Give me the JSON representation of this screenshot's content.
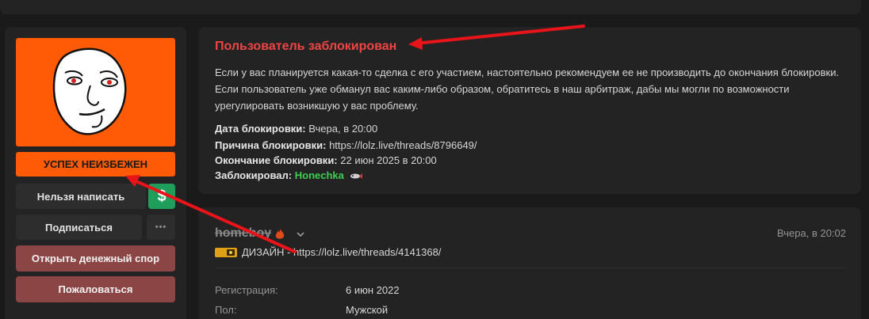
{
  "sidebar": {
    "banner_text": "УСПЕХ НЕИЗБЕЖЕН",
    "buttons": {
      "cannot_write": "Нельзя написать",
      "dollar": "$",
      "subscribe": "Подписаться",
      "more": "•••",
      "open_dispute": "Открыть денежный спор",
      "report": "Пожаловаться"
    }
  },
  "ban": {
    "title": "Пользователь заблокирован",
    "description": "Если у вас планируется какая-то сделка с его участием, настоятельно рекомендуем ее не производить до окончания блокировки. Если пользователь уже обманул вас каким-либо образом, обратитесь в наш арбитраж, дабы мы могли по возможности урегулировать возникшую у вас проблему.",
    "date_label": "Дата блокировки:",
    "date_value": "Вчера, в 20:00",
    "reason_label": "Причина блокировки:",
    "reason_value": "https://lolz.live/threads/8796649/",
    "end_label": "Окончание блокировки:",
    "end_value": "22 июн 2025 в 20:00",
    "by_label": "Заблокировал:",
    "by_value": "Honechka"
  },
  "profile": {
    "username": "homeboy",
    "time": "Вчера, в 20:02",
    "status_text": "ДИЗАЙН - https://lolz.live/threads/4141368/",
    "fields": [
      {
        "label": "Регистрация:",
        "value": "6 июн 2022"
      },
      {
        "label": "Пол:",
        "value": "Мужской"
      }
    ]
  },
  "colors": {
    "accent_orange": "#ff5a05",
    "ban_red": "#ef4444",
    "green": "#3ecf52",
    "arrow_red": "#e8141a"
  }
}
